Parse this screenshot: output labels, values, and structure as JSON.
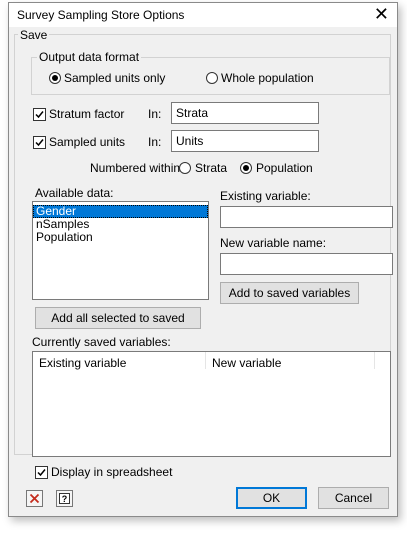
{
  "window": {
    "title": "Survey Sampling Store Options",
    "close": "✕"
  },
  "save_group": {
    "label": "Save"
  },
  "output_format": {
    "label": "Output data format",
    "options": [
      "Sampled units only",
      "Whole population"
    ],
    "selected": "Sampled units only"
  },
  "stratum_factor": {
    "label": "Stratum factor",
    "checked": true,
    "in_label": "In:",
    "value": "Strata"
  },
  "sampled_units": {
    "label": "Sampled units",
    "checked": true,
    "in_label": "In:",
    "value": "Units"
  },
  "numbered_within": {
    "label": "Numbered within:",
    "options": [
      "Strata",
      "Population"
    ],
    "selected": "Population"
  },
  "available_data": {
    "label": "Available data:",
    "items": [
      "Gender",
      "nSamples",
      "Population"
    ],
    "selected": "Gender"
  },
  "existing_variable": {
    "label": "Existing variable:",
    "value": ""
  },
  "new_variable_name": {
    "label": "New variable name:",
    "value": ""
  },
  "buttons": {
    "add_to_saved": "Add to saved variables",
    "add_all_selected": "Add all selected to saved",
    "ok": "OK",
    "cancel": "Cancel"
  },
  "saved_variables": {
    "label": "Currently saved variables:",
    "columns": [
      "Existing variable",
      "New variable"
    ]
  },
  "display_in_spreadsheet": {
    "label": "Display in spreadsheet",
    "checked": true
  },
  "icons": {
    "clear": "red-x-icon",
    "help": "help-question-icon"
  },
  "colors": {
    "selection": "#0078d7",
    "clear_icon": "#c42b1c",
    "dialog_bg": "#f0f0f0"
  }
}
